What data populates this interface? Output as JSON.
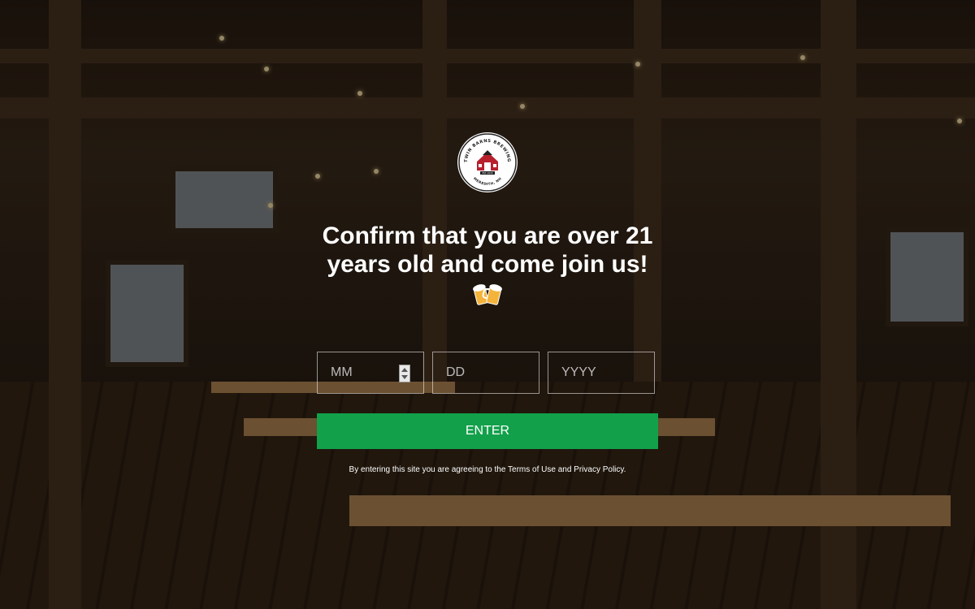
{
  "brand": {
    "logo_text_top": "TWIN BARNS BREWING",
    "logo_text_est": "EST. 2018",
    "logo_text_bottom": "MEREDITH, NH"
  },
  "age_gate": {
    "headline": "Confirm that you are over 21 years old and come join us!",
    "emoji": "clinking-beer-mugs",
    "fields": {
      "month_placeholder": "MM",
      "day_placeholder": "DD",
      "year_placeholder": "YYYY"
    },
    "enter_label": "ENTER",
    "legal_text": "By entering this site you are agreeing to the Terms of Use and Privacy Policy."
  },
  "colors": {
    "enter_button": "#12a04a",
    "overlay": "rgba(0,0,0,0.42)"
  }
}
